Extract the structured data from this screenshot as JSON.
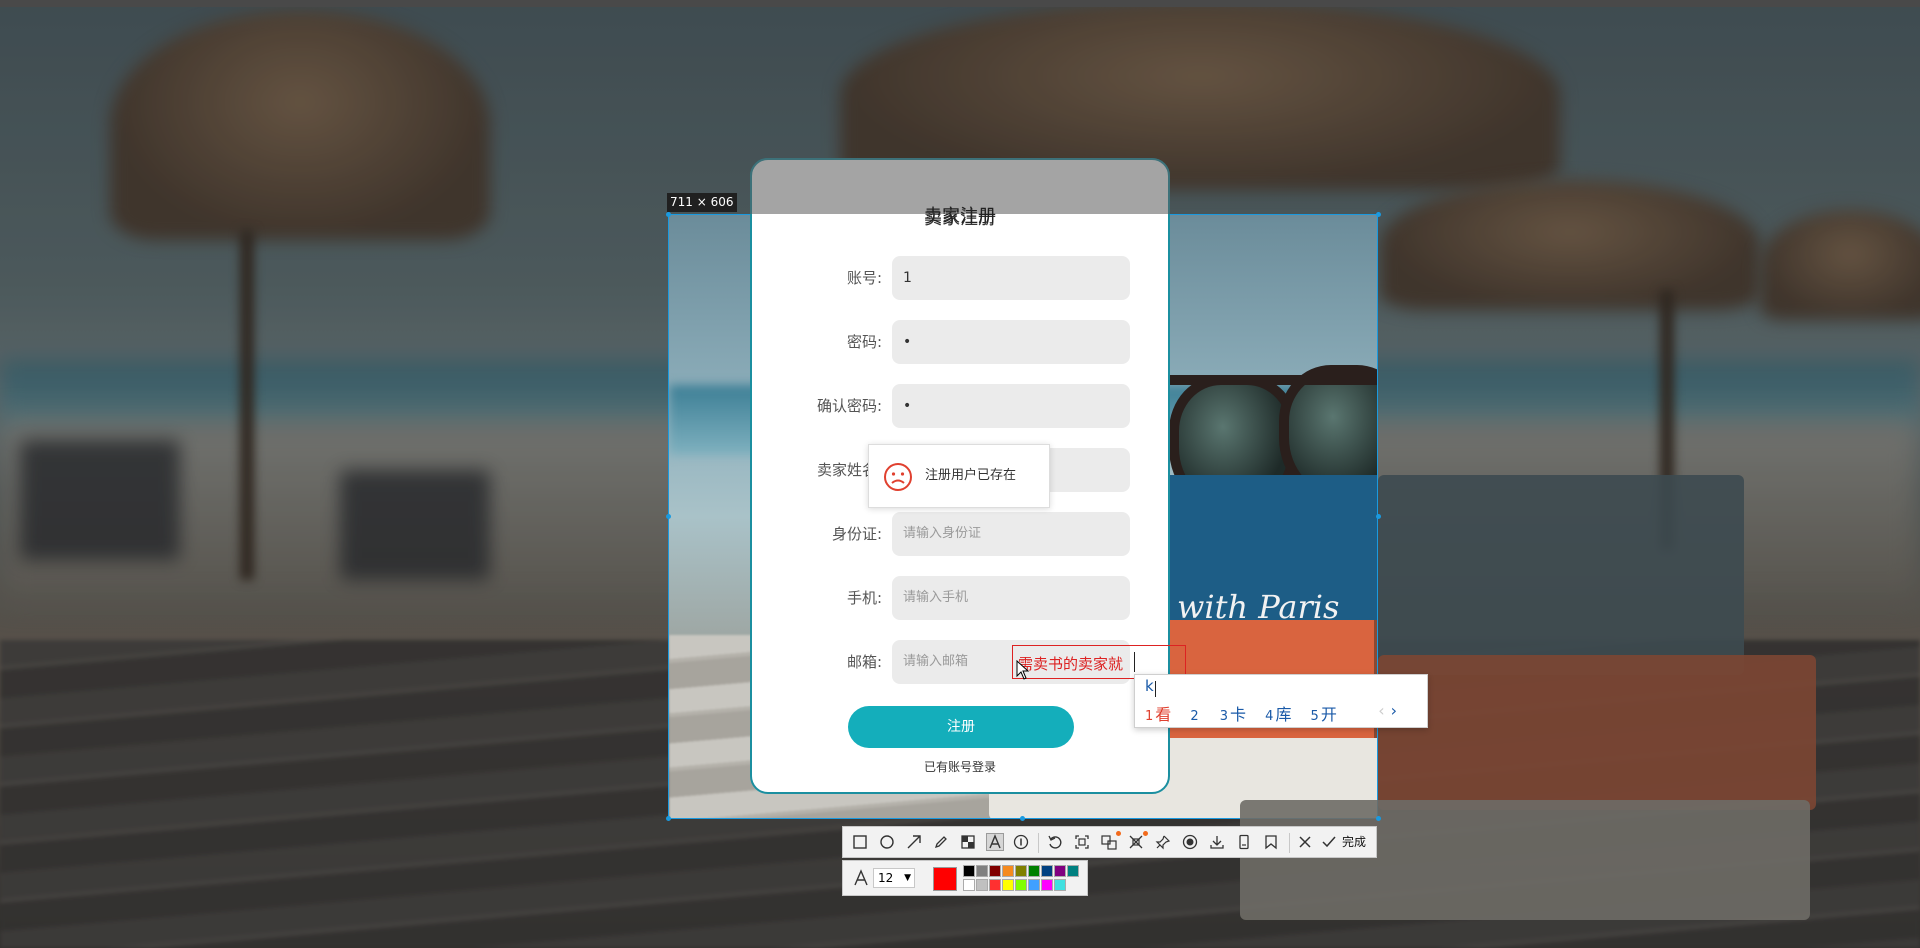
{
  "selection": {
    "size_label": "711 × 606"
  },
  "book_text": "with Paris",
  "register": {
    "title": "卖家注册",
    "fields": [
      {
        "label": "账号:",
        "value": "1",
        "placeholder": ""
      },
      {
        "label": "密码:",
        "value": "•",
        "placeholder": ""
      },
      {
        "label": "确认密码:",
        "value": "•",
        "placeholder": ""
      },
      {
        "label": "卖家姓名:",
        "value": "",
        "placeholder": ""
      },
      {
        "label": "身份证:",
        "value": "",
        "placeholder": "请输入身份证"
      },
      {
        "label": "手机:",
        "value": "",
        "placeholder": "请输入手机"
      },
      {
        "label": "邮箱:",
        "value": "",
        "placeholder": "请输入邮箱"
      }
    ],
    "submit_label": "注册",
    "login_link": "已有账号登录"
  },
  "toast": {
    "message": "注册用户已存在"
  },
  "annotation": {
    "text": "需卖书的卖家就"
  },
  "ime": {
    "composition": "k",
    "candidates": [
      {
        "num": "1",
        "text": "看"
      },
      {
        "num": "2",
        "text": ""
      },
      {
        "num": "3",
        "text": "卡"
      },
      {
        "num": "4",
        "text": "库"
      },
      {
        "num": "5",
        "text": "开"
      }
    ],
    "prev": "‹",
    "next": "›"
  },
  "toolbar": {
    "tools": [
      "rectangle-icon",
      "ellipse-icon",
      "arrow-icon",
      "pencil-icon",
      "mosaic-icon",
      "text-icon",
      "serial-number-icon",
      "undo-icon",
      "ocr-icon",
      "translate-icon",
      "scroll-capture-icon",
      "pin-icon",
      "record-icon",
      "save-icon",
      "long-screenshot-icon",
      "bookmark-icon",
      "cancel-icon",
      "done-check-icon"
    ],
    "done_label": "完成",
    "font_size": "12",
    "current_color": "#ff0000",
    "palette": [
      "#000000",
      "#808080",
      "#800000",
      "#f58a1f",
      "#808000",
      "#008000",
      "#004080",
      "#800080",
      "#008080",
      "#ffffff",
      "#c0c0c0",
      "#ff3030",
      "#ffff00",
      "#80ff00",
      "#40a0ff",
      "#ff00ff",
      "#40e0e0"
    ]
  }
}
